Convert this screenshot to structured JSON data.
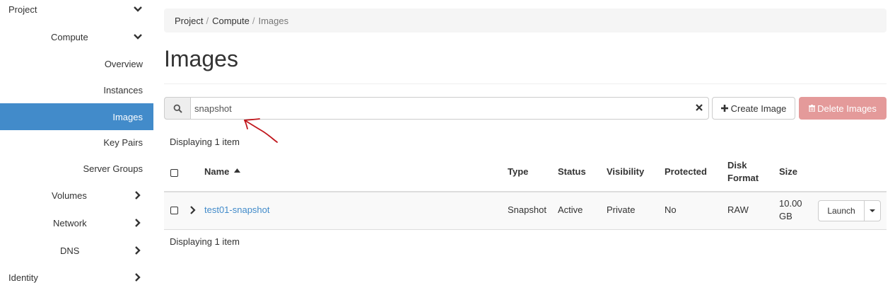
{
  "sidebar": {
    "project": "Project",
    "compute": "Compute",
    "items": [
      "Overview",
      "Instances",
      "Images",
      "Key Pairs",
      "Server Groups"
    ],
    "active": "Images",
    "volumes": "Volumes",
    "network": "Network",
    "dns": "DNS",
    "identity": "Identity"
  },
  "breadcrumb": {
    "items": [
      "Project",
      "Compute",
      "Images"
    ],
    "separator": "/"
  },
  "page": {
    "title": "Images"
  },
  "search": {
    "value": "snapshot",
    "icon": "search-icon",
    "clear_icon": "close-icon"
  },
  "actions": {
    "create": "Create Image",
    "delete": "Delete Images"
  },
  "summary": {
    "top": "Displaying 1 item",
    "bottom": "Displaying 1 item"
  },
  "table": {
    "headers": {
      "name": "Name",
      "type": "Type",
      "status": "Status",
      "visibility": "Visibility",
      "protected": "Protected",
      "disk_format_line1": "Disk",
      "disk_format_line2": "Format",
      "size": "Size"
    },
    "rows": [
      {
        "name": "test01-snapshot",
        "type": "Snapshot",
        "status": "Active",
        "visibility": "Private",
        "protected": "No",
        "disk_format": "RAW",
        "size_line1": "10.00",
        "size_line2": "GB",
        "action": "Launch"
      }
    ]
  },
  "colors": {
    "accent": "#428bca",
    "danger_disabled": "#e49a9a",
    "annotation": "#c0161c"
  }
}
